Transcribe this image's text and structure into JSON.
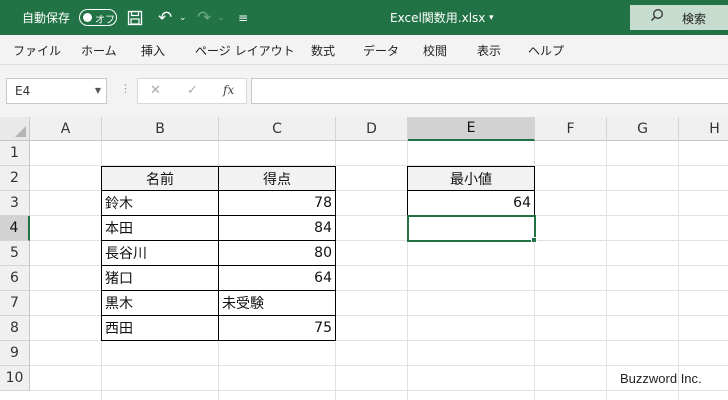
{
  "titlebar": {
    "autosave_label": "自動保存",
    "autosave_state": "オフ",
    "filename": "Excel関数用.xlsx",
    "search_label": "検索",
    "bg_color": "#217346"
  },
  "menu": [
    "ファイル",
    "ホーム",
    "挿入",
    "ページ レイアウト",
    "数式",
    "データ",
    "校閲",
    "表示",
    "ヘルプ"
  ],
  "formula_bar": {
    "name_box": "E4",
    "fx_label": "fx",
    "formula": ""
  },
  "columns": [
    "A",
    "B",
    "C",
    "D",
    "E",
    "F",
    "G",
    "H"
  ],
  "rows": [
    "1",
    "2",
    "3",
    "4",
    "5",
    "6",
    "7",
    "8",
    "9",
    "10"
  ],
  "active_cell": {
    "column": "E",
    "row": "4"
  },
  "table": {
    "headers": [
      "名前",
      "得点"
    ],
    "records": [
      {
        "name": "鈴木",
        "score": "78"
      },
      {
        "name": "本田",
        "score": "84"
      },
      {
        "name": "長谷川",
        "score": "80"
      },
      {
        "name": "猪口",
        "score": "64"
      },
      {
        "name": "黒木",
        "score": "未受験"
      },
      {
        "name": "西田",
        "score": "75"
      }
    ]
  },
  "result": {
    "header": "最小値",
    "value": "64"
  },
  "watermark": "Buzzword Inc."
}
